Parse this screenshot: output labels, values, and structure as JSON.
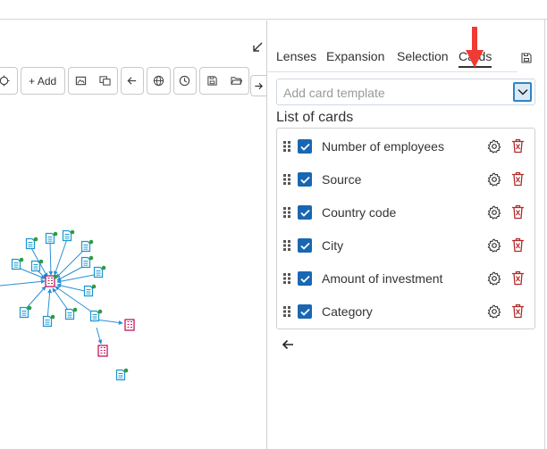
{
  "colors": {
    "accent": "#1967b2",
    "delete": "#b12a2a",
    "marker": "#ee3b34",
    "node_doc": "#1a97d0",
    "node_org": "#c2185b",
    "node_dot": "#2e9c3a"
  },
  "toolbar": {
    "add_label": "+ Add",
    "icons": [
      "target-icon",
      "add-icon",
      "image-icon",
      "duplicate-icon",
      "back-arrow-icon",
      "globe-icon",
      "clock-icon",
      "save-icon",
      "folder-icon"
    ]
  },
  "panel": {
    "tabs": [
      {
        "label": "Lenses"
      },
      {
        "label": "Expansion"
      },
      {
        "label": "Selection"
      },
      {
        "label": "Cards"
      }
    ],
    "active_tab": "Cards",
    "template_placeholder": "Add card template",
    "list_title": "List of cards",
    "cards": [
      {
        "label": "Number of employees",
        "checked": true
      },
      {
        "label": "Source",
        "checked": true
      },
      {
        "label": "Country code",
        "checked": true
      },
      {
        "label": "City",
        "checked": true
      },
      {
        "label": "Amount of investment",
        "checked": true
      },
      {
        "label": "Category",
        "checked": true
      }
    ]
  }
}
